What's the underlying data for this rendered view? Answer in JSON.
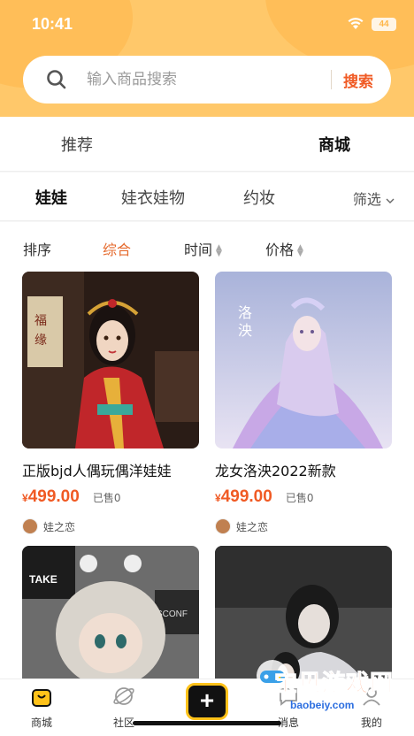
{
  "status_bar": {
    "time": "10:41",
    "battery": "44",
    "wifi_icon": "wifi-icon"
  },
  "search": {
    "placeholder": "输入商品搜索",
    "button": "搜索",
    "icon": "search-icon"
  },
  "main_tabs": [
    {
      "label": "推荐",
      "active": false
    },
    {
      "label": "商城",
      "active": true
    }
  ],
  "category_tabs": [
    {
      "label": "娃娃",
      "active": true
    },
    {
      "label": "娃衣娃物",
      "active": false
    },
    {
      "label": "约妆",
      "active": false
    }
  ],
  "filter_label": "筛选",
  "sort_options": [
    {
      "label": "排序",
      "active": false
    },
    {
      "label": "综合",
      "active": true
    },
    {
      "label": "时间",
      "active": false
    },
    {
      "label": "价格",
      "active": false
    }
  ],
  "products": [
    {
      "title": "正版bjd人偶玩偶洋娃娃",
      "currency": "¥",
      "price": "499.00",
      "sold": "已售0",
      "seller": "娃之恋"
    },
    {
      "title": "龙女洛泱2022新款",
      "currency": "¥",
      "price": "499.00",
      "sold": "已售0",
      "seller": "娃之恋"
    },
    {
      "title": "",
      "currency": "",
      "price": "",
      "sold": "",
      "seller": ""
    },
    {
      "title": "",
      "currency": "",
      "price": "",
      "sold": "",
      "seller": ""
    }
  ],
  "tabbar": [
    {
      "label": "商城",
      "icon": "shop-bag-icon"
    },
    {
      "label": "社区",
      "icon": "planet-icon"
    },
    {
      "label": "+",
      "icon": "plus-icon"
    },
    {
      "label": "消息",
      "icon": "message-icon"
    },
    {
      "label": "我的",
      "icon": "profile-icon"
    }
  ],
  "watermark": {
    "text": "宝贝游戏网",
    "url": "baobeiy.com"
  },
  "colors": {
    "accent_yellow": "#ffc21a",
    "header_bg": "#ffc86a",
    "price_orange": "#f05a24"
  }
}
